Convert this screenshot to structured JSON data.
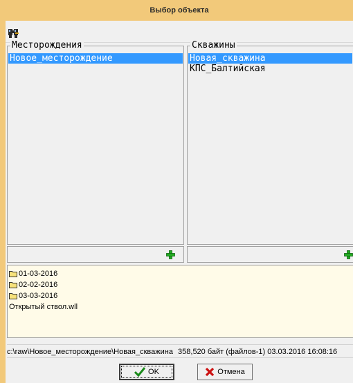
{
  "window": {
    "title": "Выбор объекта"
  },
  "toolbar": {
    "find_icon": "binoculars-icon"
  },
  "fields": {
    "legend": "Месторождения",
    "items": [
      {
        "label": "Новое_месторождение",
        "selected": true
      }
    ]
  },
  "wells": {
    "legend": "Скважины",
    "items": [
      {
        "label": "Новая_скважина",
        "selected": true
      },
      {
        "label": "КПС_Балтийская",
        "selected": false
      }
    ]
  },
  "files": {
    "items": [
      {
        "label": "01-03-2016",
        "icon": "folder-icon"
      },
      {
        "label": "02-02-2016",
        "icon": "folder-icon"
      },
      {
        "label": "03-03-2016",
        "icon": "folder-icon"
      },
      {
        "label": "Открытый ствол.wll",
        "icon": ""
      }
    ]
  },
  "status": {
    "path": "c:\\raw\\Новое_месторождение\\Новая_скважина",
    "info": "358,520 байт (файлов-1) 03.03.2016 16:08:16"
  },
  "buttons": {
    "ok_label": "OK",
    "cancel_label": "Отмена"
  },
  "colors": {
    "titlebar": "#f2c97a",
    "selection": "#3399ff",
    "filelist_bg": "#fffbe8",
    "plus": "#22aa22",
    "cancel_x": "#cc1111",
    "ok_check": "#1a8a1a"
  }
}
